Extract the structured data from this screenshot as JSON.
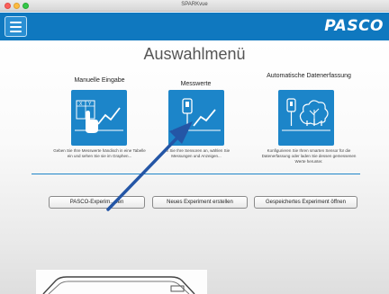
{
  "window": {
    "title": "SPARKvue"
  },
  "appbar": {
    "brand": "PASCO",
    "menu_icon": "hamburger-menu-icon"
  },
  "main": {
    "title": "Auswahlmenü",
    "cards": [
      {
        "title": "Manuelle Eingabe",
        "icon": "manual-entry-chart-icon",
        "description": "Geben Sie Ihre Messwerte händisch in eine Tabelle ein und sehen Sie sie im Graphen..."
      },
      {
        "title": "Messwerte",
        "icon": "sensor-data-icon",
        "description": "...n Sie Ihre Sensoren an, wählen Sie Messungen und Anzeigen..."
      },
      {
        "title": "Automatische Datenerfassung",
        "icon": "automatic-data-collection-icon",
        "description": "Konfigurieren Sie Ihren smarten Sensor für die Datenerfassung oder laden Sie dessen gemessenen Werte herunter."
      }
    ],
    "buttons": {
      "pasco_experiments": "PASCO-Experim...nen",
      "new_experiment": "Neues Experiment erstellen",
      "open_saved": "Gespeichertes Experiment öffnen"
    }
  },
  "colors": {
    "brand_blue": "#0f78bf",
    "tile_blue": "#1c85c9",
    "arrow_blue": "#2456a6"
  }
}
